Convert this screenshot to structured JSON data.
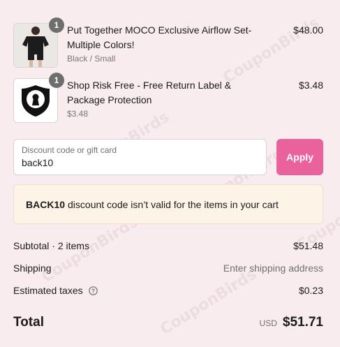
{
  "watermark": "CouponBirds",
  "line_items": [
    {
      "quantity": "1",
      "title": "Put Together MOCO Exclusive Airflow Set- Multiple Colors!",
      "variant": "Black / Small",
      "price": "$48.00",
      "image_icon": "black-tshirt-shorts-set-photo"
    },
    {
      "quantity": "1",
      "title": "Shop Risk Free - Free Return Label & Package Protection",
      "variant": "$3.48",
      "price": "$3.48",
      "image_icon": "shield-keyhole-icon"
    }
  ],
  "discount": {
    "label": "Discount code or gift card",
    "value": "back10",
    "apply_label": "Apply",
    "accent_color": "#e9629c"
  },
  "notice": {
    "code": "BACK10",
    "message": "discount code isn’t valid for the items in your cart"
  },
  "summary": {
    "subtotal_label": "Subtotal · 2 items",
    "subtotal_value": "$51.48",
    "shipping_label": "Shipping",
    "shipping_value": "Enter shipping address",
    "taxes_label": "Estimated taxes",
    "taxes_value": "$0.23",
    "total_label": "Total",
    "currency": "USD",
    "total_value": "$51.71"
  }
}
